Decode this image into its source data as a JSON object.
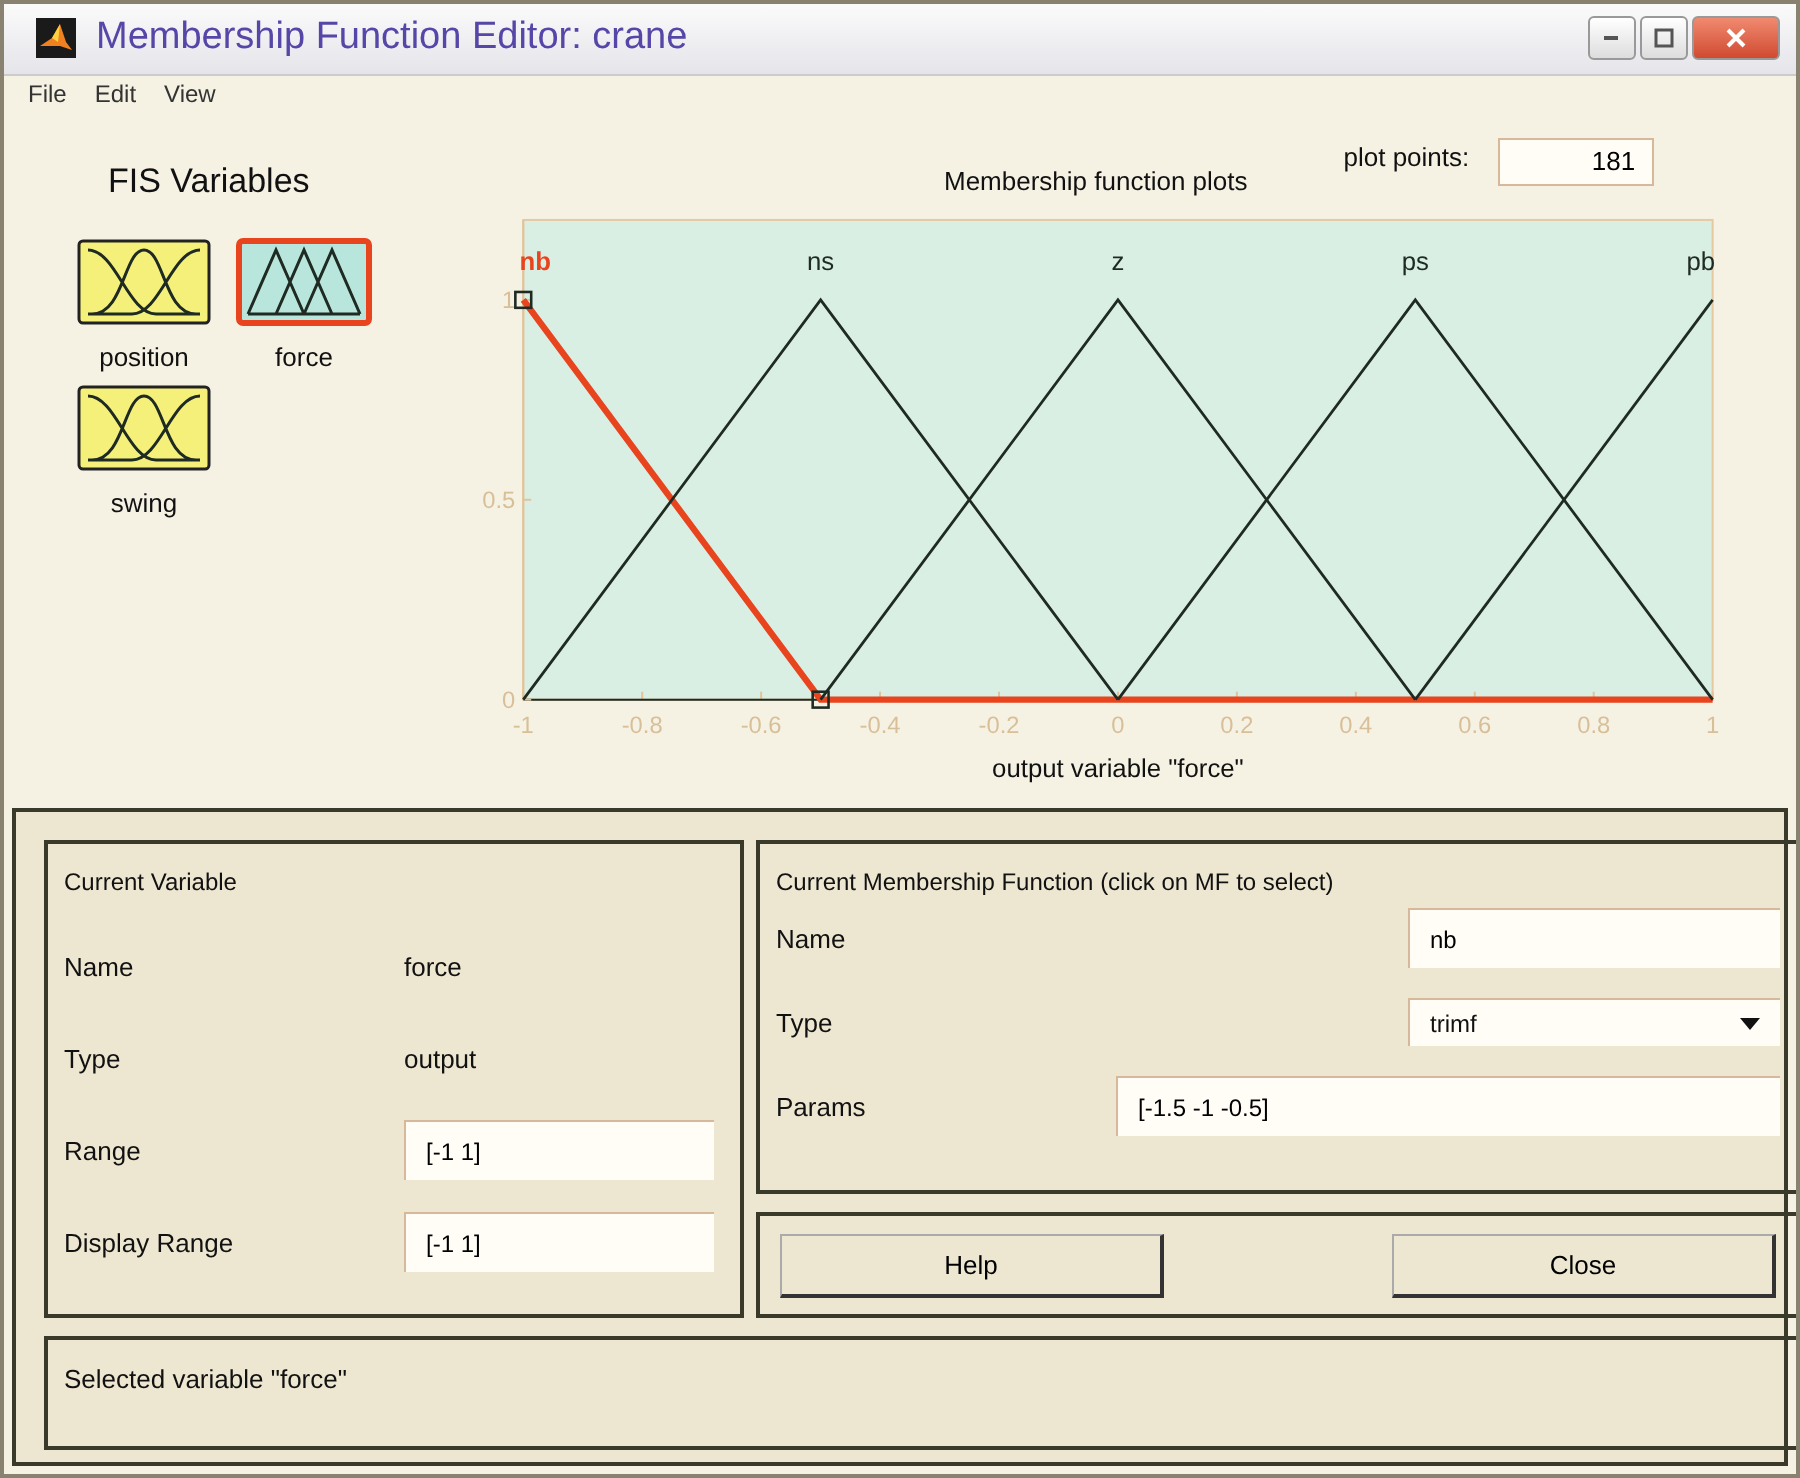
{
  "window": {
    "title": "Membership Function Editor: crane"
  },
  "menu": [
    "File",
    "Edit",
    "View"
  ],
  "fis_variables": {
    "title": "FIS Variables",
    "items": [
      {
        "label": "position",
        "kind": "input",
        "selected": false
      },
      {
        "label": "force",
        "kind": "output",
        "selected": true
      },
      {
        "label": "swing",
        "kind": "input",
        "selected": false
      }
    ]
  },
  "plot": {
    "plot_points_label": "plot points:",
    "plot_points": "181",
    "functions": [
      {
        "selected": true
      },
      {
        "selected": false
      },
      {
        "selected": false
      },
      {
        "selected": false
      },
      {
        "selected": false
      }
    ],
    "chart_data": {
      "type": "line",
      "title": "Membership function plots",
      "xlabel": "output variable \"force\"",
      "x": [
        -1,
        -0.5,
        0,
        0.5,
        1
      ],
      "series": [
        {
          "name": "nb",
          "color": "#e8451e",
          "values": [
            1,
            0,
            0,
            0,
            0
          ]
        },
        {
          "name": "ns",
          "color": "#1e2a22",
          "values": [
            0,
            1,
            0,
            null,
            null
          ]
        },
        {
          "name": "z",
          "color": "#1e2a22",
          "values": [
            null,
            0,
            1,
            0,
            null
          ]
        },
        {
          "name": "ps",
          "color": "#1e2a22",
          "values": [
            null,
            null,
            0,
            1,
            0
          ]
        },
        {
          "name": "pb",
          "color": "#1e2a22",
          "values": [
            null,
            null,
            null,
            0,
            1
          ]
        }
      ],
      "xlim": [
        -1,
        1
      ],
      "ylim": [
        0,
        1.2
      ],
      "xticks": [
        -1,
        -0.8,
        -0.6,
        -0.4,
        -0.2,
        0,
        0.2,
        0.4,
        0.6,
        0.8,
        1
      ],
      "yticks": [
        0,
        0.5,
        1
      ]
    }
  },
  "current_variable": {
    "title": "Current Variable",
    "rows": [
      {
        "label": "Name",
        "kind": "text",
        "value": "force"
      },
      {
        "label": "Type",
        "kind": "text",
        "value": "output"
      },
      {
        "label": "Range",
        "kind": "field",
        "value": "[-1 1]"
      },
      {
        "label": "Display Range",
        "kind": "field",
        "value": "[-1 1]"
      }
    ]
  },
  "current_mf": {
    "title": "Current Membership Function (click on MF to select)",
    "name_label": "Name",
    "name": "nb",
    "type_label": "Type",
    "type": "trimf",
    "params_label": "Params",
    "params": "[-1.5 -1 -0.5]"
  },
  "buttons": [
    "Help",
    "Close"
  ],
  "status": "Selected variable \"force\""
}
